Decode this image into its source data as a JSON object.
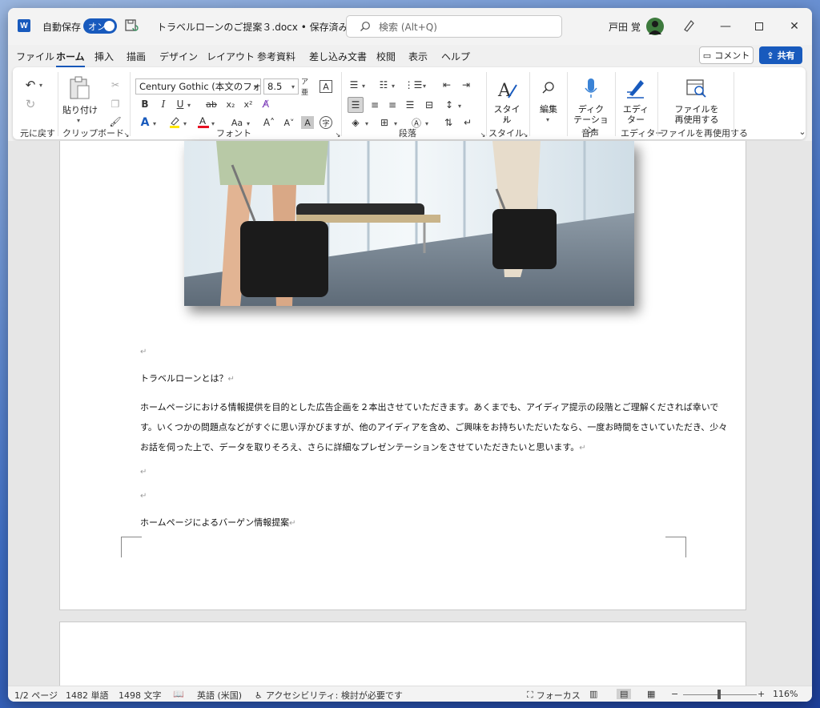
{
  "titlebar": {
    "app_logo": "W",
    "autosave_label": "自動保存",
    "autosave_state": "オン",
    "doc_title": "トラベルローンのご提案３.docx • 保存済み",
    "search_placeholder": "検索 (Alt+Q)",
    "user_name": "戸田 覚"
  },
  "tabs": [
    "ファイル",
    "ホーム",
    "挿入",
    "描画",
    "デザイン",
    "レイアウト",
    "参考資料",
    "差し込み文書",
    "校閲",
    "表示",
    "ヘルプ"
  ],
  "active_tab": "ホーム",
  "actions": {
    "comment": "コメント",
    "share": "共有"
  },
  "ribbon": {
    "groups": {
      "undo": "元に戻す",
      "clipboard": "クリップボード",
      "font": "フォント",
      "paragraph": "段落",
      "styles": "スタイル",
      "voice": "音声",
      "editor": "エディター",
      "reuse": "ファイルを再使用する"
    },
    "paste_label": "貼り付け",
    "font_name": "Century Gothic (本文のフォン",
    "font_size": "8.5",
    "styles_label": "スタイル",
    "editing_label": "編集",
    "dictation_label": [
      "ディク",
      "テーション"
    ],
    "editor_label": [
      "エディ",
      "ター"
    ],
    "reuse_label": [
      "ファイルを",
      "再使用する"
    ],
    "bold": "B",
    "italic": "I",
    "underline": "U",
    "strike": "ab",
    "subscript": "x₂",
    "superscript": "x²",
    "font_color_icon": "A",
    "size_up": "A˄",
    "size_down": "A˅",
    "case": "Aa"
  },
  "document": {
    "lines": [
      "トラベルローンとは？",
      "ホームページにおける情報提供を目的とした広告企画を２本出させていただきます。あくまでも、アイディア提示の段階とご理解くだされば幸いで",
      "す。いくつかの問題点などがすぐに思い浮かびますが、他のアイディアを含め、ご興味をお持ちいただいたなら、一度お時間をさいていただき、少々",
      "お話を伺った上で、データを取りそろえ、さらに詳細なプレゼンテーションをさせていただきたいと思います。",
      "ホームページによるバーゲン情報提案"
    ],
    "para_mark": "↵"
  },
  "status": {
    "page": "1/2 ページ",
    "words": "1482 単語",
    "chars": "1498 文字",
    "language": "英語 (米国)",
    "accessibility": "アクセシビリティ: 検討が必要です",
    "focus": "フォーカス",
    "zoom_minus": "−",
    "zoom_plus": "+",
    "zoom": "116%"
  },
  "colors": {
    "accent": "#185abd",
    "font_red": "#e81123",
    "highlight_yellow": "#ffe600"
  }
}
